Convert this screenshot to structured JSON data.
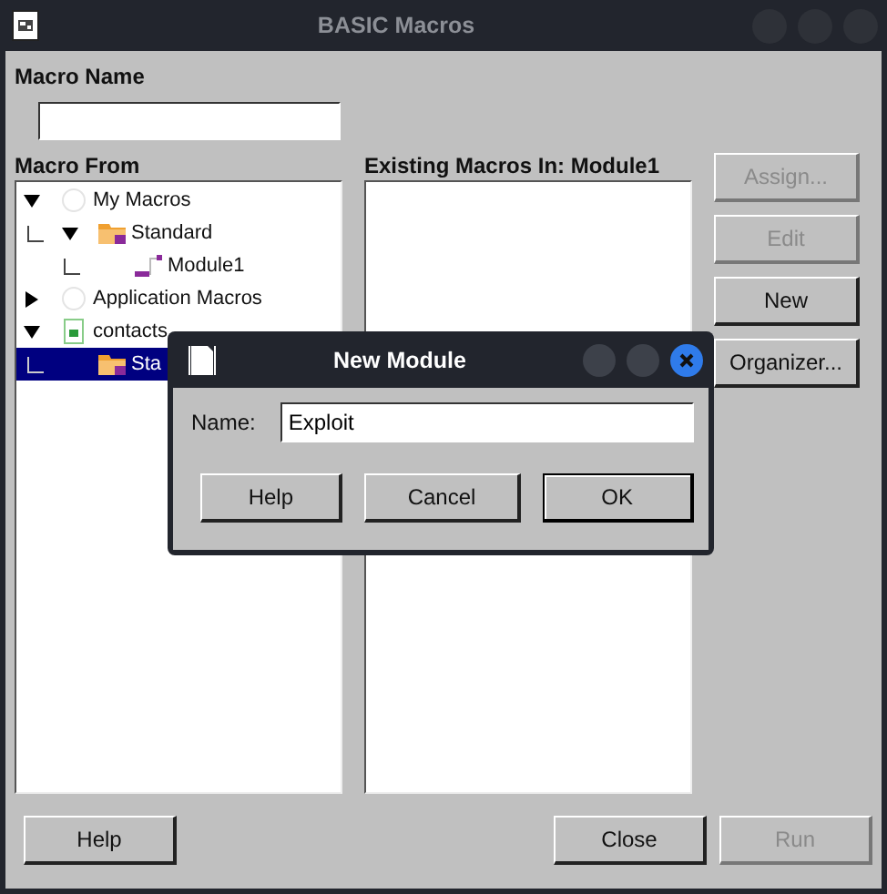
{
  "window": {
    "title": "BASIC Macros"
  },
  "macro_name": {
    "label": "Macro Name"
  },
  "macro_from": {
    "label": "Macro From",
    "tree": [
      {
        "label": "My Macros",
        "kind": "library",
        "expanded": true,
        "selected": false,
        "children": [
          {
            "label": "Standard",
            "kind": "folder",
            "expanded": true,
            "selected": false,
            "children": [
              {
                "label": "Module1",
                "kind": "module",
                "selected": false
              }
            ]
          }
        ]
      },
      {
        "label": "Application Macros",
        "kind": "library",
        "expanded": false,
        "selected": false
      },
      {
        "label": "contacts",
        "kind": "document",
        "expanded": true,
        "selected": false,
        "children": [
          {
            "label": "Sta",
            "kind": "folder",
            "selected": true
          }
        ]
      }
    ]
  },
  "existing": {
    "label": "Existing Macros In: Module1"
  },
  "side_buttons": [
    {
      "label": "Assign...",
      "disabled": true
    },
    {
      "label": "Edit",
      "disabled": true
    },
    {
      "label": "New",
      "disabled": false
    },
    {
      "label": "Organizer...",
      "disabled": false
    }
  ],
  "bottom_buttons": [
    {
      "label": "Help",
      "disabled": false
    },
    {
      "label": "Close",
      "disabled": false
    },
    {
      "label": "Run",
      "disabled": true
    }
  ],
  "modal": {
    "title": "New Module",
    "name_label": "Name:",
    "name_value": "Exploit",
    "buttons": [
      {
        "label": "Help",
        "default": false
      },
      {
        "label": "Cancel",
        "default": false
      },
      {
        "label": "OK",
        "default": true
      }
    ]
  }
}
